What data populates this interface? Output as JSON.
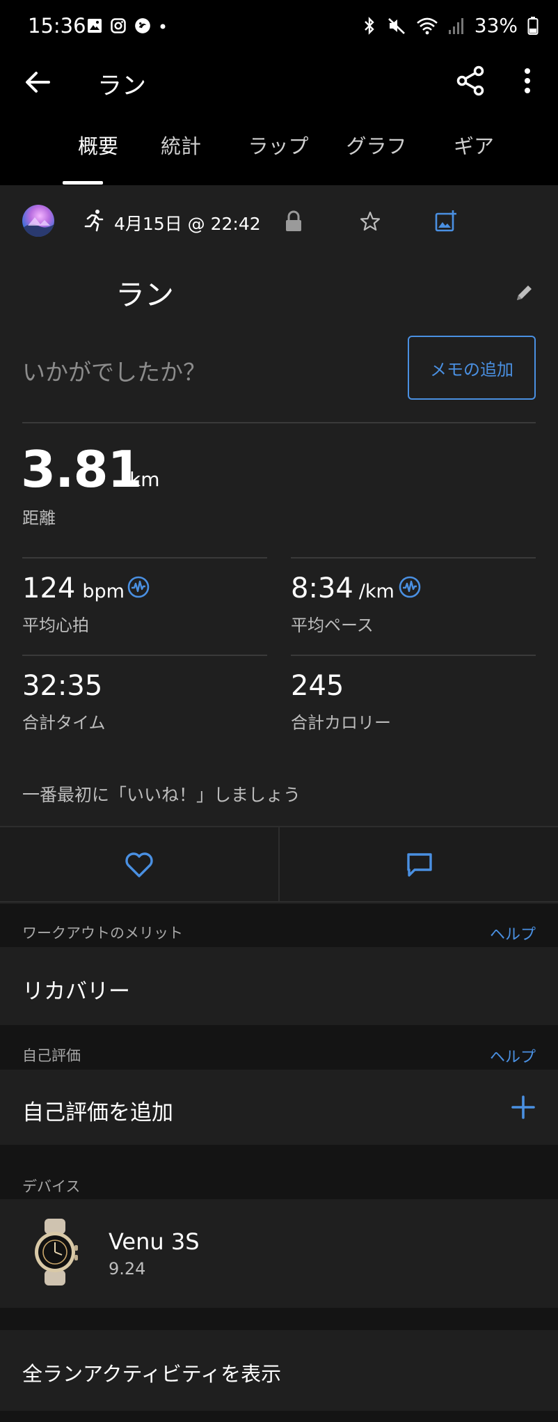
{
  "status_bar": {
    "time": "15:36",
    "battery": "33%",
    "left_icons": [
      "gallery-icon",
      "instagram-icon",
      "app-icon",
      "dot"
    ],
    "right_icons": [
      "bluetooth-icon",
      "mute-icon",
      "wifi-icon",
      "signal-icon",
      "battery-icon"
    ]
  },
  "app_bar": {
    "title": "ラン"
  },
  "tabs": [
    {
      "label": "概要",
      "active": true
    },
    {
      "label": "統計",
      "active": false
    },
    {
      "label": "ラップ",
      "active": false
    },
    {
      "label": "グラフ",
      "active": false
    },
    {
      "label": "ギア",
      "active": false
    }
  ],
  "activity": {
    "date": "4月15日 @ 22:42",
    "title": "ラン",
    "feeling_prompt": "いかがでしたか？",
    "memo_button": "メモの追加"
  },
  "distance": {
    "value": "3.81",
    "unit": "km",
    "label": "距離"
  },
  "stats": {
    "heart_rate": {
      "value": "124",
      "unit": "bpm",
      "label": "平均心拍"
    },
    "pace": {
      "value": "8:34",
      "unit": "/km",
      "label": "平均ペース"
    },
    "time": {
      "value": "32:35",
      "label": "合計タイム"
    },
    "calories": {
      "value": "245",
      "label": "合計カロリー"
    }
  },
  "like_prompt": "一番最初に「いいね！」しましょう",
  "workout_benefit": {
    "section_label": "ワークアウトのメリット",
    "help": "ヘルプ",
    "value": "リカバリー"
  },
  "self_evaluation": {
    "section_label": "自己評価",
    "help": "ヘルプ",
    "add_label": "自己評価を追加"
  },
  "device": {
    "section_label": "デバイス",
    "name": "Venu 3S",
    "version": "9.24"
  },
  "all_activities_link": "全ランアクティビティを表示",
  "colors": {
    "accent": "#4a90e2",
    "background": "#1f1f1f",
    "topbar": "#000000"
  }
}
